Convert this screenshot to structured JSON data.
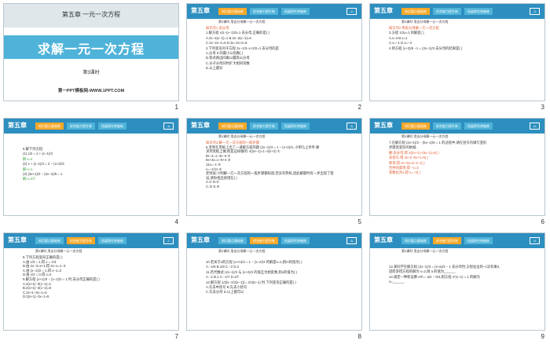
{
  "slides": [
    {
      "number": "1",
      "chapter": "第五章  一元一次方程",
      "title": "求解一元一次方程",
      "subtitle": "第3课时",
      "site": "第一PPT模板网-WWW.1PPT.COM"
    },
    {
      "number": "2",
      "header": {
        "chapter": "第五章",
        "tabs": [
          "知识要点基础练",
          "综合能力提升练",
          "拓展探究突破练"
        ],
        "page": "-2-"
      },
      "sub": "第3课时  用去分母解一元一次方程",
      "lines": [
        "知识点1  去分母",
        "1.解方程 x/2−(x−1)/3=1 去分母,正确的是(   )",
        "A.3x−2(x−1)=1     B.3x−2(x−1)=6",
        "C.3x−2x−1=6       D.3x−2x+2=6",
        "2.下列变形对于方程 2x−1/3−x+2/2=1 去分母的是",
        "A.分母 6 的最小公倍数(   )",
        "B.等式两边同乘以最简公分母",
        "C.分子分母同时扩大相同倍数",
        "D.以上都对"
      ]
    },
    {
      "number": "3",
      "header": {
        "chapter": "第五章",
        "tabs": [
          "知识要点基础练",
          "综合能力提升练",
          "拓展探究突破练"
        ],
        "page": "-3-"
      },
      "sub": "第3课时  用去分母解一元一次方程",
      "lines": [
        "知识点2  用去分母解一元一次方程",
        "3.方程 1/2x=1 的解是(   )",
        "A.x=4     B.x=1",
        "C.x=−1    D.x=−4",
        "4.将方程 (x+2)/6 −1 = (2x−1)/3 去分母的结果是(   )"
      ]
    },
    {
      "number": "4",
      "header": {
        "chapter": "第五章",
        "tabs": [
          "知识要点基础练",
          "综合能力提升练",
          "拓展探究突破练"
        ],
        "page": "-4-"
      },
      "sub": "",
      "lines": [
        "5.解下列方程:",
        "(1) x/2 = 1 + (x−1)/3",
        "解:x=4",
        "(2) x + (x−1)/2 = 2 − (x+2)/3",
        "解:x=1",
        "(3) (3x+1)/2 − (2x−1)/6 = 1",
        "解:x=4/7"
      ]
    },
    {
      "number": "5",
      "header": {
        "chapter": "第五章",
        "tabs": [
          "知识要点基础练",
          "综合能力提升练",
          "拓展探究突破练"
        ],
        "page": "-5-"
      },
      "sub": "第3课时  用去分母解一元一次方程",
      "lines": [
        "知识点3  解一元一次方程的一般步骤",
        "6.老师在黑板上出了一道解方程的题 (2x−1)/3 = 1 − (x+2)/4, 小明马上举手,要",
        "求到黑板上做,他是这样做的: 4(2x−1)=1−3(x+2)  ①",
        "8x−4=1−3x−6  ②",
        "8x+3x=1−6+4  ③",
        "11x=−1  ④",
        "x=−1/11  ⑤",
        "老师说:小明解一元一次方程的一般步骤都知道,但没有熟练,因此解题时有一步出现了错",
        "误,请你指出他错在(   )",
        "A.①   B.②",
        "C.③   D.④"
      ]
    },
    {
      "number": "6",
      "header": {
        "chapter": "第五章",
        "tabs": [
          "知识要点基础练",
          "综合能力提升练",
          "拓展探究突破练"
        ],
        "page": "-6-"
      },
      "sub": "第3课时  用去分母解一元一次方程",
      "lines": [
        "7.在解方程 (2x+1)/3 − (5x−1)/6 = 1 的过程中,请在括号内填写变形",
        "步骤及变形的依据.",
        "解:去分母,得 2(2x+1)−(5x−1)=6(   )",
        "去括号,得 4x+2−5x+1=6(   )",
        "移项,得 4x−5x=6−2−1(   )",
        "合并同类项,得 −x=3",
        "系数化为1,得 x=−3(   )"
      ]
    },
    {
      "number": "7",
      "header": {
        "chapter": "第五章",
        "tabs": [
          "知识要点基础练",
          "综合能力提升练",
          "拓展探究突破练"
        ],
        "page": "-7-"
      },
      "sub": "第3课时  用去分母解一元一次方程",
      "lines": [
        "8.下列方程变形正确的是(   )",
        "A.由 x/3 = 1,得 x = 1/3",
        "B.由 2x−3=x+1,得 2x−x=1−3",
        "C.由 (x−1)/2 = 1,得 x−1=2",
        "D.由 x/2 = 0,得 x=2",
        "9.解方程 (x+1)/3 − (x−1)/2 = 1 时,去分母正确的是(   )",
        "A.2(x+1)−3(x−1)=1",
        "B.2(x+1)−3(x−1)=6",
        "C.2x+1−3x−1=6",
        "D.2(x+1)−3x−1=6"
      ]
    },
    {
      "number": "8",
      "header": {
        "chapter": "第五章",
        "tabs": [
          "知识要点基础练",
          "综合能力提升练",
          "拓展探究突破练"
        ],
        "page": "-8-"
      },
      "sub": "第3课时  用去分母解一元一次方程",
      "lines": [
        "10.若关于x的方程 (x+m)/3 = 1 − (x−2)/2 的解是x=1,则m的值为(   )",
        "A.−1/8     B.1/8     C.−2     D.2",
        "11.若代数式 (2x−1)/3 与 (x+2)/2 的值互为相反数,则x的值为(   )",
        "A.−1     B.1     C.−1/7     D.1/7",
        "12.解方程 1/2[x−1/2(x−1)] = 2/3(x−1) 时,下列变形正确的是(   )",
        "A.先去中括号     B.先去小括号",
        "C.先去分母       D.以上都可以"
      ]
    },
    {
      "number": "9",
      "header": {
        "chapter": "第五章",
        "tabs": [
          "知识要点基础练",
          "综合能力提升练",
          "拓展探究突破练"
        ],
        "page": "-9-"
      },
      "sub": "第3课时  用去分母解一元一次方程",
      "lines": [
        "13.某同学在解方程 (2x−1)/3 = (x+a)/3 − 1 去分母时,方程右边的−1没有乘3,",
        "因而求得方程的解为 x=2,则 a 的值为______.",
        "14.规定一种新运算 a*b = a/2 − b/3,则方程 x*(x−1) = 1 的解为",
        "x=______."
      ]
    }
  ]
}
